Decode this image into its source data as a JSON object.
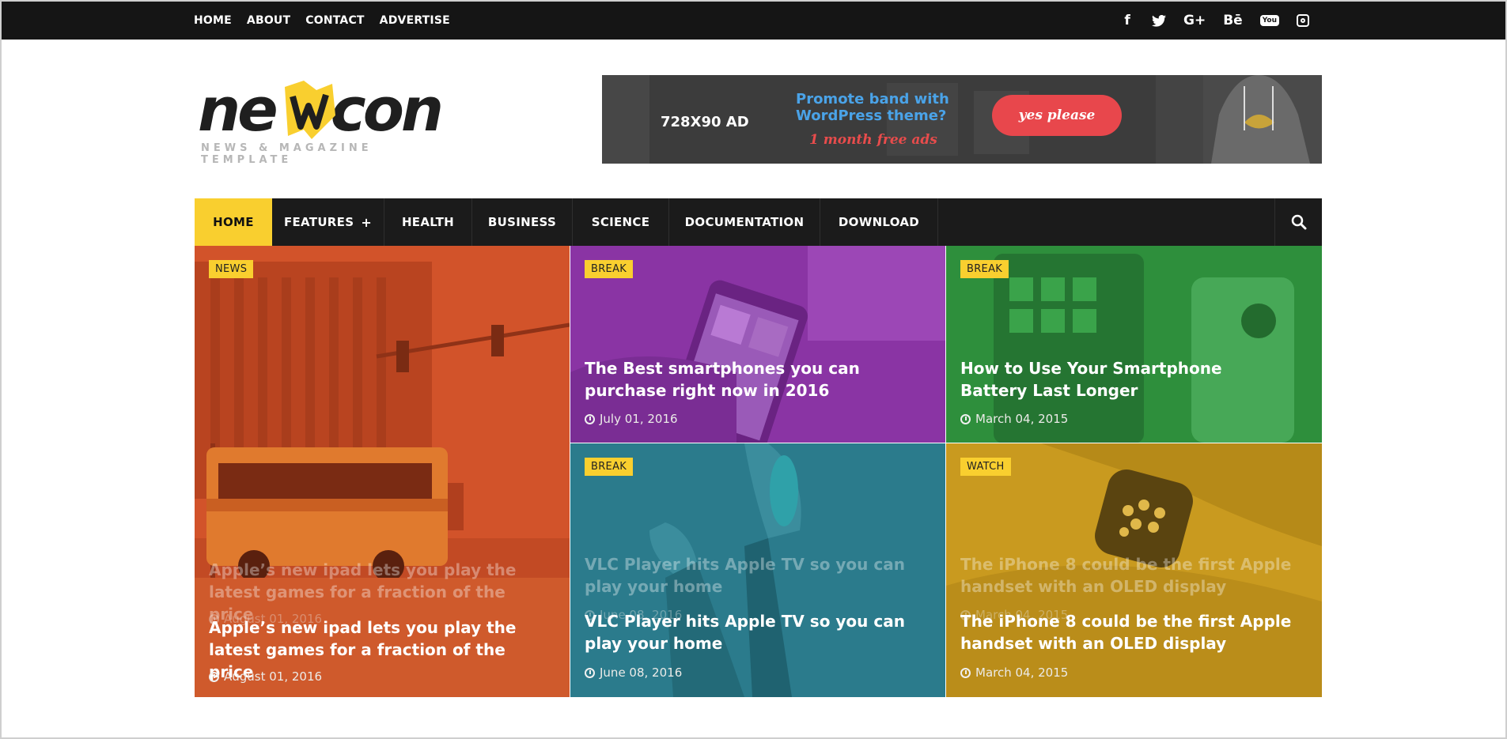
{
  "topbar": {
    "nav": [
      "HOME",
      "ABOUT",
      "CONTACT",
      "ADVERTISE"
    ],
    "social_icons": [
      "facebook-icon",
      "twitter-icon",
      "google-plus-icon",
      "behance-icon",
      "youtube-icon",
      "instagram-icon"
    ],
    "social_glyphs": {
      "facebook": "f",
      "twitter": "🐦",
      "google": "G+",
      "behance": "Bē",
      "youtube": "You"
    }
  },
  "logo": {
    "word_left": "ne",
    "word_right": "con",
    "tagline": "NEWS & MAGAZINE TEMPLATE"
  },
  "ad": {
    "size": "728X90 AD",
    "promo_line1": "Promote band with",
    "promo_line2": "WordPress theme?",
    "free": "1 month free ads",
    "button": "yes please"
  },
  "mainnav": {
    "items": [
      "HOME",
      "FEATURES",
      "HEALTH",
      "BUSINESS",
      "SCIENCE",
      "DOCUMENTATION",
      "DOWNLOAD"
    ],
    "plus": "+"
  },
  "posts": [
    {
      "badge": "NEWS",
      "title": "Apple’s new ipad lets you play the latest games for a fraction of the price",
      "date": "August 01, 2016",
      "color": "#d2532a"
    },
    {
      "badge": "BREAK",
      "title": "The Best smartphones you can purchase right now in 2016",
      "date": "July 01, 2016",
      "color": "#8a34a4"
    },
    {
      "badge": "BREAK",
      "title": "How to Use Your Smartphone Battery Last Longer",
      "date": "March 04, 2015",
      "color": "#2e8f3c"
    },
    {
      "badge": "BREAK",
      "title": "VLC Player hits Apple TV so you can play your home",
      "date": "June 08, 2016",
      "color": "#2b7b8c"
    },
    {
      "badge": "WATCH",
      "title": "The iPhone 8 could be the first Apple handset with an OLED display",
      "date": "March 04, 2015",
      "color": "#c99a1f"
    }
  ],
  "colors": {
    "accent": "#f9cf2f",
    "dark": "#151515",
    "ad_button": "#e8474c"
  }
}
